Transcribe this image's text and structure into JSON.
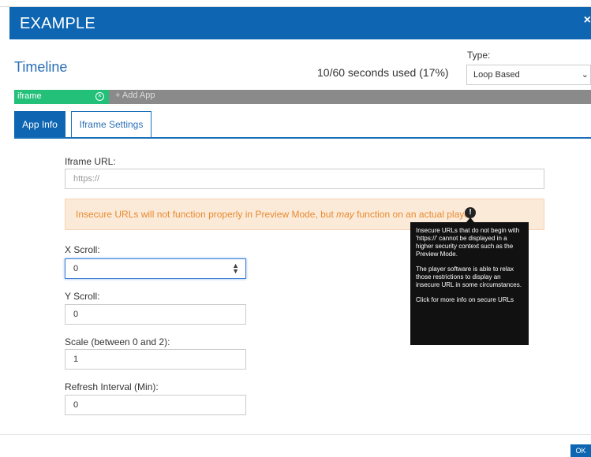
{
  "dialog": {
    "title": "EXAMPLE",
    "close_glyph": "×"
  },
  "timeline": {
    "label": "Timeline",
    "seconds_used": "10/60 seconds used (17%)",
    "type_label": "Type:",
    "type_value": "Loop Based",
    "app_chip_label": "iframe",
    "add_app_label": "+ Add App"
  },
  "tabs": [
    {
      "label": "App Info"
    },
    {
      "label": "Iframe Settings"
    }
  ],
  "form": {
    "iframe_url_label": "Iframe URL:",
    "iframe_url_placeholder": "https://",
    "warning_prefix": "Insecure URLs will not function properly in Preview Mode, but ",
    "warning_emphasis": "may",
    "warning_suffix": " function on an actual player.",
    "x_scroll_label": "X Scroll:",
    "x_scroll_value": "0",
    "y_scroll_label": "Y Scroll:",
    "y_scroll_value": "0",
    "scale_label": "Scale (between 0 and 2):",
    "scale_value": "1",
    "refresh_label": "Refresh Interval (Min):",
    "refresh_value": "0"
  },
  "tooltip": {
    "para1": "Insecure URLs that do not begin with 'https://' cannot be displayed in a higher security context such as the Preview Mode.",
    "para2": "The player software is able to relax those restrictions to display an insecure URL in some circumstances.",
    "para3": "Click for more info on secure URLs"
  },
  "footer": {
    "ok_label": "OK"
  },
  "colors": {
    "brand_blue": "#0e66b3",
    "chip_green": "#23c07a",
    "warning_bg": "#fcead9",
    "warning_text": "#e68a2e"
  },
  "icons": {
    "close": "close-icon",
    "chip_remove": "remove-circle-icon",
    "info": "info-circle-icon",
    "stepper": "stepper-arrows-icon",
    "dropdown": "chevron-down-icon"
  }
}
